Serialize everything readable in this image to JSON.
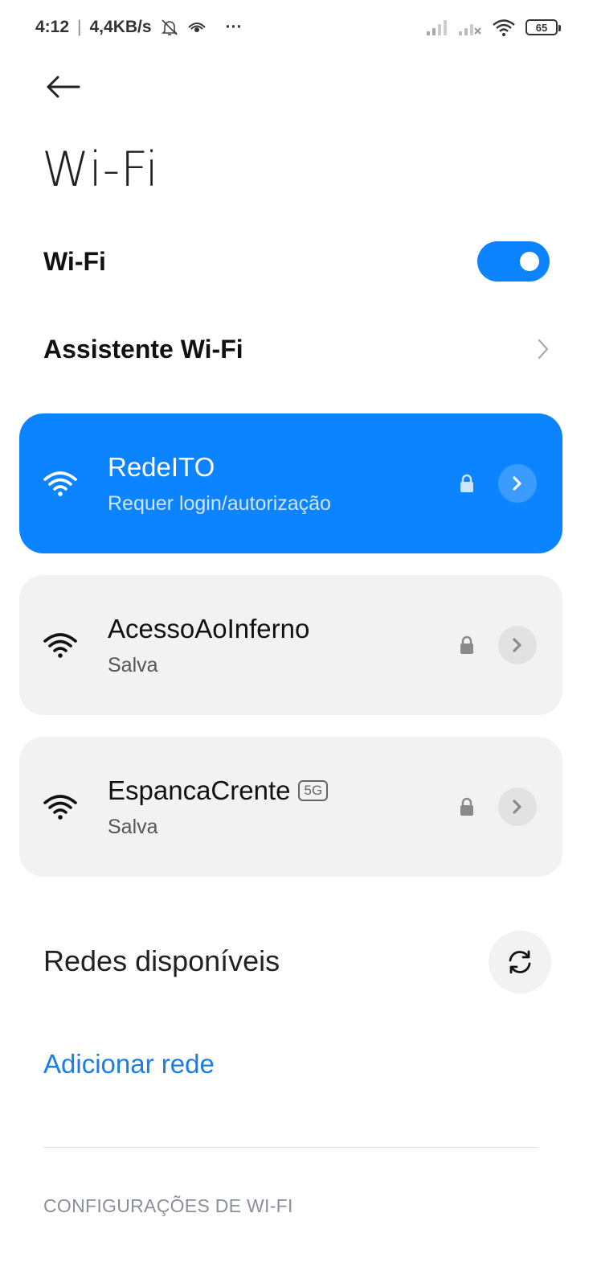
{
  "status_bar": {
    "time": "4:12",
    "separator": "|",
    "speed": "4,4KB/s",
    "more": "···",
    "battery": "65"
  },
  "header": {
    "title": "Wi-Fi"
  },
  "wifi_toggle": {
    "label": "Wi-Fi",
    "enabled": true
  },
  "assistant": {
    "label": "Assistente Wi-Fi"
  },
  "networks": [
    {
      "name": "RedeITO",
      "status": "Requer login/autorização",
      "secured": true,
      "connected": true,
      "badge": ""
    },
    {
      "name": "AcessoAoInferno",
      "status": "Salva",
      "secured": true,
      "connected": false,
      "badge": ""
    },
    {
      "name": "EspancaCrente",
      "status": "Salva",
      "secured": true,
      "connected": false,
      "badge": "5G"
    }
  ],
  "available": {
    "title": "Redes disponíveis",
    "refresh_icon": "refresh-icon"
  },
  "add_network": {
    "label": "Adicionar rede"
  },
  "settings": {
    "header": "CONFIGURAÇÕES DE WI-FI"
  },
  "colors": {
    "accent": "#0d84ff",
    "link": "#1a7ee6",
    "card_bg": "#f2f2f2"
  }
}
